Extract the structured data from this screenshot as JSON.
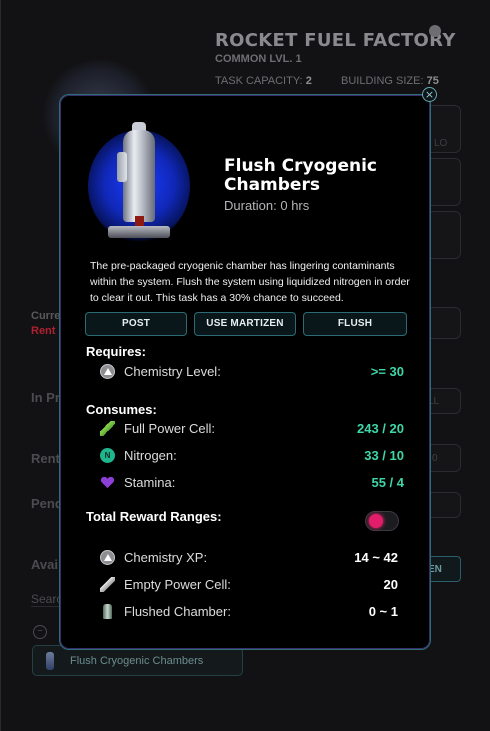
{
  "background": {
    "building_title": "ROCKET FUEL FACTORY",
    "rarity_level": "COMMON LVL. 1",
    "task_capacity_label": "TASK CAPACITY:",
    "task_capacity_value": "2",
    "building_size_label": "BUILDING SIZE:",
    "building_size_value": "75",
    "current_label": "Curre",
    "rent_label": "Rent",
    "in_progress_label": "In Pr",
    "rent_section_label": "Rent",
    "pending_label": "Pend",
    "available_label": "Avai",
    "search_placeholder": "Searc",
    "task_item_label": "Flush Cryogenic Chambers",
    "side_button_label": "EN",
    "side_hint_1": "LL",
    "side_hint_2": "0",
    "side_hint_3": "LO"
  },
  "modal": {
    "close_icon": "close-icon",
    "task_title": "Flush Cryogenic Chambers",
    "duration": "Duration: 0 hrs",
    "description": "The pre-packaged cryogenic chamber has lingering contaminants within the system. Flush the system using liquidized nitrogen in order to clear it out. This task has a 30% chance to succeed.",
    "actions": {
      "post": "POST",
      "use_martizen": "USE MARTIZEN",
      "flush": "FLUSH"
    },
    "requires": {
      "heading": "Requires:",
      "items": [
        {
          "icon": "chemistry-icon",
          "label": "Chemistry Level:",
          "value": ">= 30"
        }
      ]
    },
    "consumes": {
      "heading": "Consumes:",
      "items": [
        {
          "icon": "full-power-cell-icon",
          "label": "Full Power Cell:",
          "value": "243 / 20"
        },
        {
          "icon": "nitrogen-icon",
          "label": "Nitrogen:",
          "value": "33 / 10",
          "icon_letter": "N"
        },
        {
          "icon": "stamina-heart-icon",
          "label": "Stamina:",
          "value": "55 / 4"
        }
      ]
    },
    "rewards": {
      "heading": "Total Reward Ranges:",
      "toggle_on": false,
      "items": [
        {
          "icon": "chemistry-icon",
          "label": "Chemistry XP:",
          "value": "14 ~ 42"
        },
        {
          "icon": "empty-power-cell-icon",
          "label": "Empty Power Cell:",
          "value": "20"
        },
        {
          "icon": "flushed-chamber-icon",
          "label": "Flushed Chamber:",
          "value": "0 ~ 1"
        }
      ]
    },
    "colors": {
      "accent_teal": "#3fd6a8",
      "border_teal": "#2e6a74",
      "toggle_pink": "#e21d6a",
      "glow_blue": "#1d3cff"
    }
  }
}
